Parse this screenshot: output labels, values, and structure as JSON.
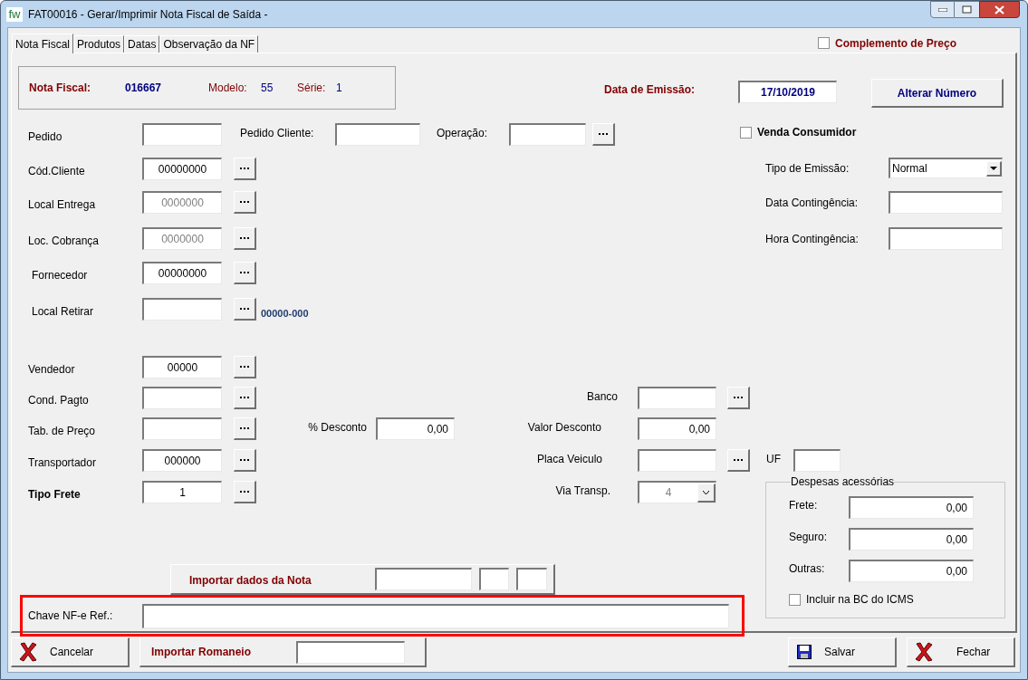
{
  "window": {
    "logo": "fw",
    "title": "FAT00016 - Gerar/Imprimir Nota Fiscal de Saída -"
  },
  "tabs": [
    {
      "label": "Nota Fiscal",
      "selected": true
    },
    {
      "label": "Produtos",
      "selected": false
    },
    {
      "label": "Datas",
      "selected": false
    },
    {
      "label": "Observação da NF",
      "selected": false
    }
  ],
  "complemento_preco": {
    "label": "Complemento de Preço",
    "checked": false
  },
  "header": {
    "nota_label": "Nota Fiscal:",
    "nota_value": "016667",
    "modelo_label": "Modelo:",
    "modelo_value": "55",
    "serie_label": "Série:",
    "serie_value": "1",
    "data_label": "Data de Emissão:",
    "data_value": "17/10/2019",
    "alterar_button": "Alterar Número"
  },
  "pedido_row": {
    "pedido_label": "Pedido",
    "pedido_cliente_label": "Pedido Cliente:",
    "operacao_label": "Operação:"
  },
  "venda_consumidor": {
    "label": "Venda Consumidor",
    "checked": false
  },
  "lookup_fields": [
    {
      "label": "Cód.Cliente",
      "value": "00000000",
      "disabled": false
    },
    {
      "label": "Local Entrega",
      "value": "0000000",
      "disabled": true
    },
    {
      "label": "Loc. Cobrança",
      "value": "0000000",
      "disabled": true
    },
    {
      "label": "Fornecedor",
      "value": "00000000",
      "disabled": false
    },
    {
      "label": "Local Retirar",
      "note": "00000-000"
    }
  ],
  "emission": [
    {
      "label": "Tipo de Emissão:",
      "kind": "select",
      "value": "Normal"
    },
    {
      "label": "Data Contingência:",
      "kind": "text"
    },
    {
      "label": "Hora Contingência:",
      "kind": "text"
    }
  ],
  "commercial": [
    {
      "label": "Vendedor",
      "value": "00000",
      "bold": false
    },
    {
      "label": "Cond. Pagto",
      "bold": false
    },
    {
      "label": "Tab. de Preço",
      "bold": false
    },
    {
      "label": "Transportador",
      "value": "000000",
      "bold": false
    },
    {
      "label": "Tipo Frete",
      "value": "1",
      "bold": true
    }
  ],
  "discount": {
    "percent_label": "% Desconto",
    "percent_value": "0,00",
    "valor_label": "Valor Desconto",
    "valor_value": "0,00"
  },
  "banco_label": "Banco",
  "placa_label": "Placa Veiculo",
  "uf_label": "UF",
  "via_transp": {
    "label": "Via Transp.",
    "value": "4",
    "disabled": true
  },
  "despesas": {
    "title": "Despesas acessórias",
    "rows": [
      {
        "label": "Frete:",
        "value": "0,00"
      },
      {
        "label": "Seguro:",
        "value": "0,00"
      },
      {
        "label": "Outras:",
        "value": "0,00"
      }
    ],
    "icms": {
      "label": "Incluir na BC do ICMS",
      "checked": false
    }
  },
  "importar_nota": {
    "label": "Importar dados da Nota"
  },
  "chave": {
    "label": "Chave NF-e Ref.:",
    "highlighted": true
  },
  "footer": {
    "cancel": "Cancelar",
    "importar_romaneio": "Importar Romaneio",
    "save": "Salvar",
    "close": "Fechar"
  }
}
